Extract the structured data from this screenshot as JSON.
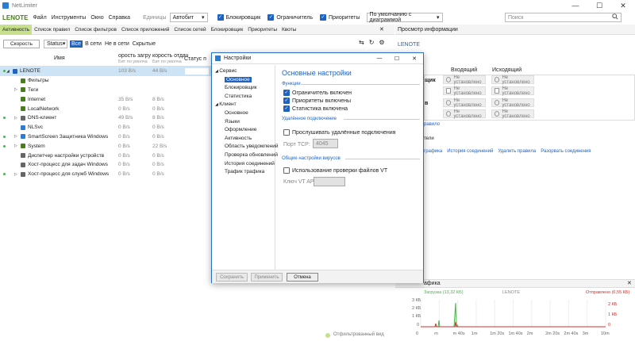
{
  "window": {
    "title": "NetLimiter",
    "minimize": "—",
    "maximize": "☐",
    "close": "✕"
  },
  "menu": {
    "brand": "LENOTE",
    "items": [
      "Файл",
      "Инструменты",
      "Окно",
      "Справка"
    ],
    "units_label": "Единицы",
    "units_value": "Автобит",
    "checks": [
      {
        "label": "Блокировщик",
        "checked": true
      },
      {
        "label": "Ограничитель",
        "checked": true
      },
      {
        "label": "Приоритеты",
        "checked": true
      }
    ],
    "view_value": "По умолчанию с диаграммой",
    "search_placeholder": "Поиск"
  },
  "tabs": [
    "Активность",
    "Список правил",
    "Список фильтров",
    "Список приложений",
    "Список сетей",
    "Блокировщик",
    "Приоритеты",
    "Квоты"
  ],
  "toolbar": {
    "speed": "Скорость",
    "status": "Status",
    "all": "Все",
    "in_net": "В сети",
    "not_in_net": "Не в сети",
    "hidden": "Скрытые"
  },
  "columns": {
    "name": "Имя",
    "down": "орость загру",
    "down_sub": "Бит по умолча",
    "up": "корость отдач",
    "up_sub": "Бит по умолча",
    "status": "Статус п"
  },
  "rows": [
    {
      "name": "LENOTE",
      "v1": "103 B/s",
      "v2": "44 B/s",
      "sel": true,
      "exp": "◢",
      "dot": true,
      "icon": "computer-icon",
      "color": "#1e63c4",
      "indent": 0
    },
    {
      "name": "Фильтры",
      "v1": "",
      "v2": "",
      "exp": "",
      "icon": "filter-icon",
      "color": "#4a7d1c",
      "indent": 1
    },
    {
      "name": "Теги",
      "v1": "",
      "v2": "",
      "exp": "▷",
      "icon": "tag-icon",
      "color": "#4a7d1c",
      "indent": 1
    },
    {
      "name": "Internet",
      "v1": "35 B/s",
      "v2": "8 B/s",
      "exp": "",
      "icon": "filter-icon",
      "color": "#4a7d1c",
      "indent": 1
    },
    {
      "name": "LocalNetwork",
      "v1": "0 B/s",
      "v2": "0 B/s",
      "exp": "",
      "icon": "filter-icon",
      "color": "#4a7d1c",
      "indent": 1
    },
    {
      "name": "DNS-клиент",
      "v1": "49 B/s",
      "v2": "8 B/s",
      "exp": "▷",
      "dot": true,
      "icon": "gear-icon",
      "color": "#666",
      "indent": 1
    },
    {
      "name": "NLSvc",
      "v1": "0 B/s",
      "v2": "0 B/s",
      "exp": "",
      "icon": "app-icon",
      "color": "#2b7cd3",
      "indent": 1
    },
    {
      "name": "SmartScreen Защитника Windows",
      "v1": "0 B/s",
      "v2": "0 B/s",
      "exp": "▷",
      "dot": true,
      "icon": "shield-icon",
      "color": "#2b7cd3",
      "indent": 1
    },
    {
      "name": "System",
      "v1": "0 B/s",
      "v2": "22 B/s",
      "exp": "▷",
      "dot": true,
      "icon": "system-icon",
      "color": "#4a7d1c",
      "indent": 1
    },
    {
      "name": "Диспетчер настройки устройств",
      "v1": "0 B/s",
      "v2": "0 B/s",
      "exp": "",
      "icon": "gear-icon",
      "color": "#666",
      "indent": 1
    },
    {
      "name": "Хост-процесс для задач Windows",
      "v1": "0 B/s",
      "v2": "0 B/s",
      "exp": "",
      "icon": "gear-icon",
      "color": "#666",
      "indent": 1
    },
    {
      "name": "Хост-процесс для служб Windows",
      "v1": "0 B/s",
      "v2": "0 B/s",
      "exp": "▷",
      "dot": true,
      "icon": "gear-icon",
      "color": "#666",
      "indent": 1
    }
  ],
  "footer_left": "Отфильтрованный вид",
  "right_panel": {
    "title": "Просмотр информации",
    "host": "LENOTE",
    "incoming": "Входящий",
    "outgoing": "Исходящий",
    "row_labels": [
      "щик",
      "",
      "в"
    ],
    "not_set": "Не установлено",
    "link1": "равило",
    "link2": "тели",
    "links": [
      "графика",
      "История соединений",
      "Удалить правила",
      "Разорвать соединения"
    ]
  },
  "dialog": {
    "title": "Настройки",
    "minimize": "—",
    "maximize": "☐",
    "close": "✕",
    "tree": [
      {
        "label": "Сервис",
        "level": 0,
        "exp": "◢"
      },
      {
        "label": "Основное",
        "level": 1,
        "sel": true
      },
      {
        "label": "Блокировщик",
        "level": 1
      },
      {
        "label": "Статистика",
        "level": 1
      },
      {
        "label": "Клиент",
        "level": 0,
        "exp": "◢"
      },
      {
        "label": "Основное",
        "level": 1
      },
      {
        "label": "Языки",
        "level": 1
      },
      {
        "label": "Оформление",
        "level": 1
      },
      {
        "label": "Активность",
        "level": 1
      },
      {
        "label": "Область уведомлений",
        "level": 1
      },
      {
        "label": "Проверка обновлений",
        "level": 1
      },
      {
        "label": "История соединений",
        "level": 1
      },
      {
        "label": "Трафик трафика",
        "level": 1
      }
    ],
    "heading": "Основные настройки",
    "functions_label": "Функции",
    "functions": [
      "Ограничитель включен",
      "Приоритеты включены",
      "Статистика включена"
    ],
    "remote_label": "Удалённое подключение",
    "remote_check": "Прослушивать удалённые подключения",
    "tcp_label": "Порт TCP:",
    "tcp_value": "4045",
    "virus_label": "Общие настройки вирусов",
    "vt_check": "Использование проверки файлов VT",
    "vt_key_label": "Ключ VT API:",
    "buttons": {
      "save": "Сохранить",
      "apply": "Применить",
      "cancel": "Отмена"
    }
  },
  "graph": {
    "title": "афика",
    "host": "LENOTE",
    "down_label": "Загрузка (13,32 КБ)",
    "up_label": "Отправлено (6,55 КБ)",
    "y_left": [
      "3 КБ",
      "2 КБ",
      "1 КБ",
      "0"
    ],
    "y_right": [
      "2 КБ",
      "1 КБ",
      "0"
    ],
    "x_ticks": [
      "0",
      "m",
      "m 40s",
      "1m",
      "1m 20s",
      "1m 40s",
      "2m",
      "2m 20s",
      "2m 40s",
      "3m",
      "10m"
    ]
  },
  "colors": {
    "accent": "#1e63c4",
    "brand": "#4a7d1c",
    "active_tab": "#c6e08c",
    "download": "#4caf50",
    "upload": "#d32f2f"
  }
}
